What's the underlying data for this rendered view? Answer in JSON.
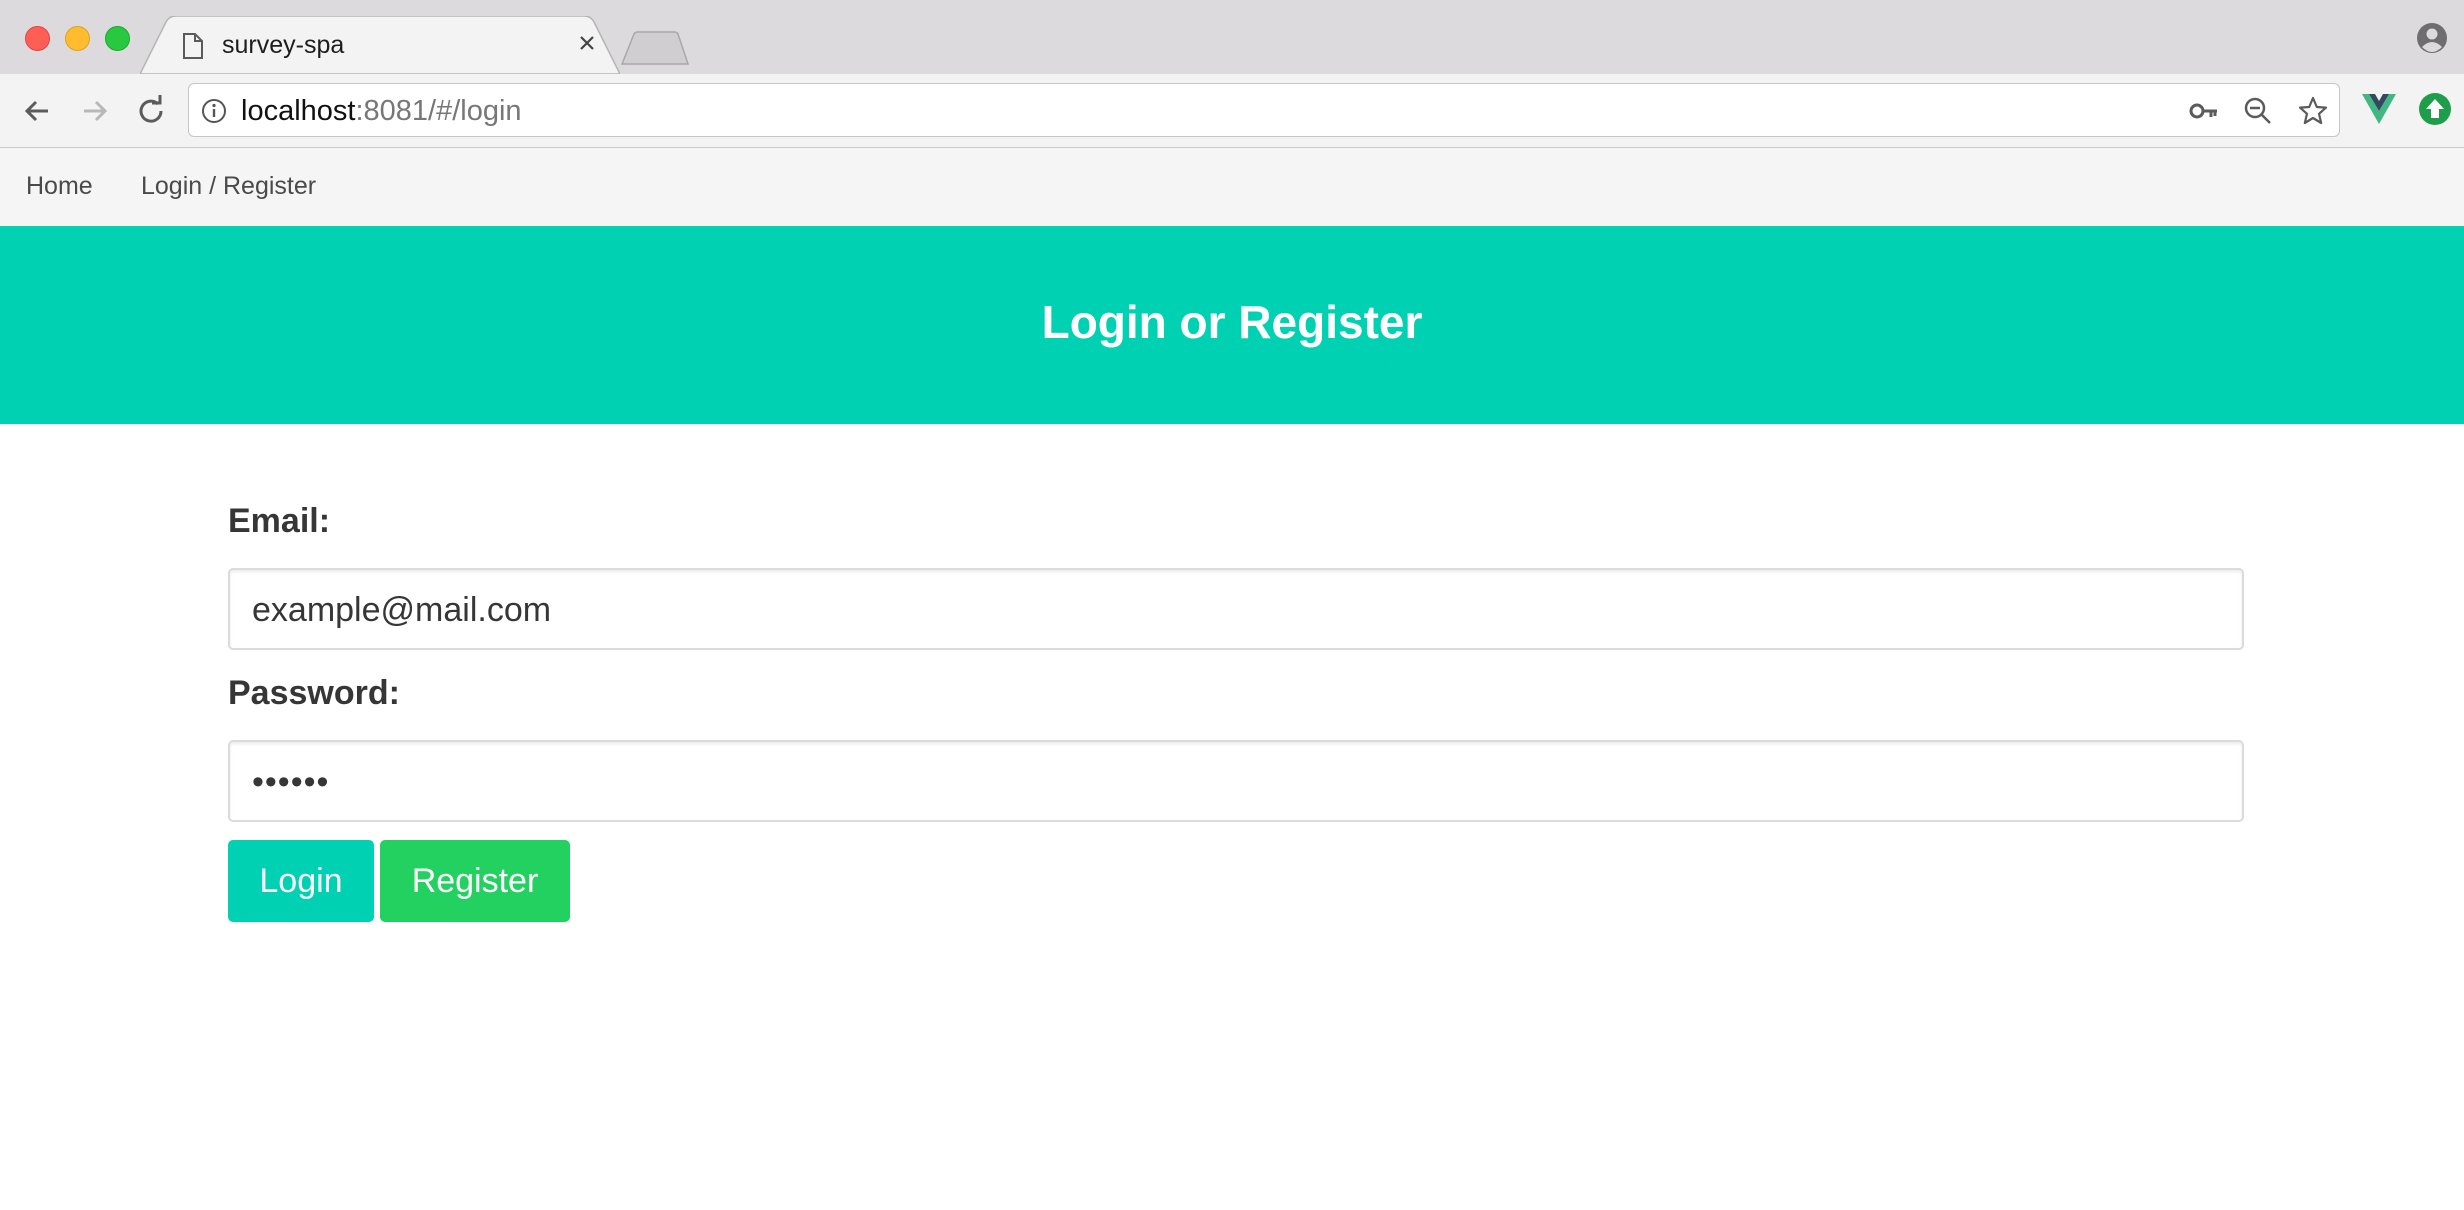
{
  "browser": {
    "tab_title": "survey-spa",
    "url_host": "localhost",
    "url_rest": ":8081/#/login"
  },
  "navbar": {
    "items": [
      {
        "label": "Home"
      },
      {
        "label": "Login / Register"
      }
    ]
  },
  "hero": {
    "title": "Login or Register"
  },
  "form": {
    "email_label": "Email:",
    "email_value": "example@mail.com",
    "password_label": "Password:",
    "password_value": "••••••",
    "login_button": "Login",
    "register_button": "Register"
  },
  "colors": {
    "primary": "#00d1b2",
    "success": "#23d160",
    "navbar_bg": "#f5f5f5"
  },
  "icons": [
    "document-icon",
    "close-icon",
    "new-tab-icon",
    "profile-icon",
    "back-icon",
    "forward-icon",
    "reload-icon",
    "info-icon",
    "key-icon",
    "zoom-out-icon",
    "star-icon",
    "vue-devtools-icon",
    "extension-update-icon"
  ]
}
